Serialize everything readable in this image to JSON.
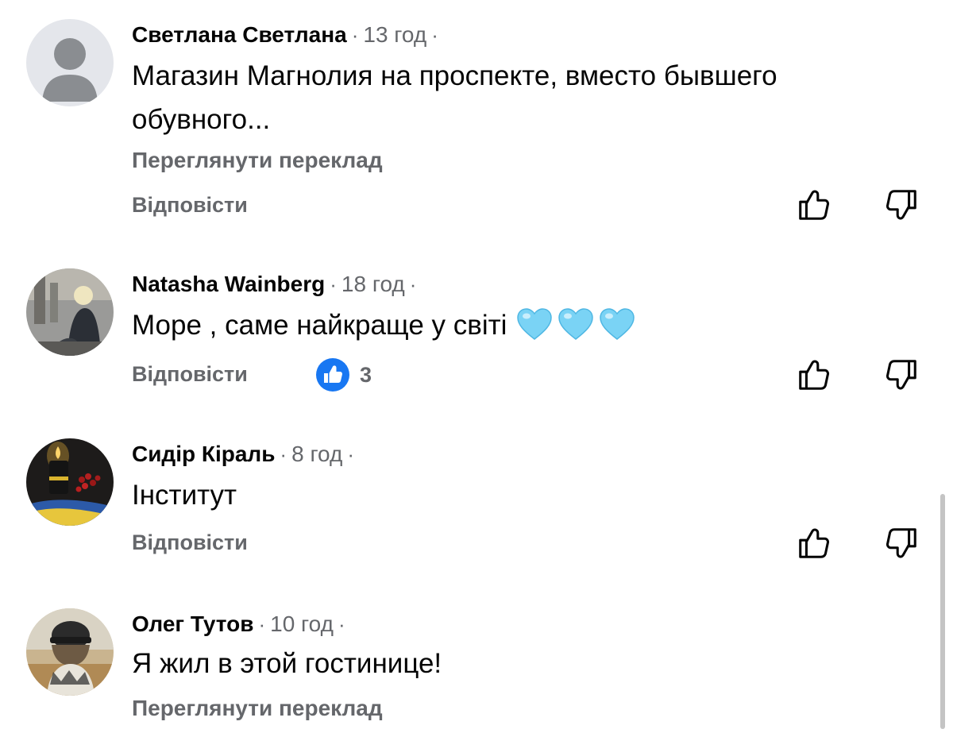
{
  "comments": [
    {
      "author": "Светлана Светлана",
      "time": "13 год",
      "text": "Магазин Магнолия на проспекте, вместо бывшего обувного...",
      "translate_label": "Переглянути переклад",
      "reply_label": "Відповісти"
    },
    {
      "author": "Natasha Wainberg",
      "time": "18 год",
      "text": "Море ,  саме найкраще у світі",
      "emoji": [
        "light-blue-heart",
        "light-blue-heart",
        "light-blue-heart"
      ],
      "reply_label": "Відповісти",
      "like_count": "3"
    },
    {
      "author": "Сидір Кіраль",
      "time": "8 год",
      "text": "Інститут",
      "reply_label": "Відповісти"
    },
    {
      "author": "Олег Тутов",
      "time": "10 год",
      "text": "Я жил в этой гостинице!",
      "translate_label": "Переглянути переклад"
    }
  ],
  "separator": "·",
  "colors": {
    "text_primary": "#050505",
    "text_secondary": "#65676b",
    "like_blue": "#1877f2",
    "heart_blue": "#7ad3f5"
  },
  "icons": {
    "like": "thumbs-up-outline-icon",
    "dislike": "thumbs-down-outline-icon",
    "like_reaction": "blue-like-reaction-icon"
  }
}
